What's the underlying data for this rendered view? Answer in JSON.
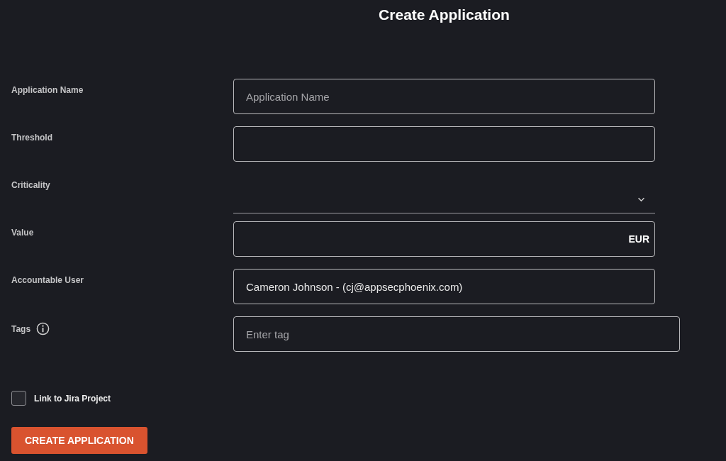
{
  "title": "Create Application",
  "fields": [
    {
      "kind": "text",
      "label": "Application Name",
      "placeholder": "Application Name"
    },
    {
      "kind": "text",
      "label": "Threshold"
    },
    {
      "kind": "select",
      "label": "Criticality"
    },
    {
      "kind": "text",
      "label": "Value",
      "suffix": "EUR"
    },
    {
      "kind": "text",
      "label": "Accountable User",
      "value": "Cameron Johnson - (cj@appsecphoenix.com)"
    },
    {
      "kind": "tags",
      "label": "Tags",
      "info": true,
      "placeholder": "Enter tag"
    }
  ],
  "checkbox": {
    "label": "Link to Jira Project",
    "checked": false
  },
  "button": "CREATE APPLICATION"
}
